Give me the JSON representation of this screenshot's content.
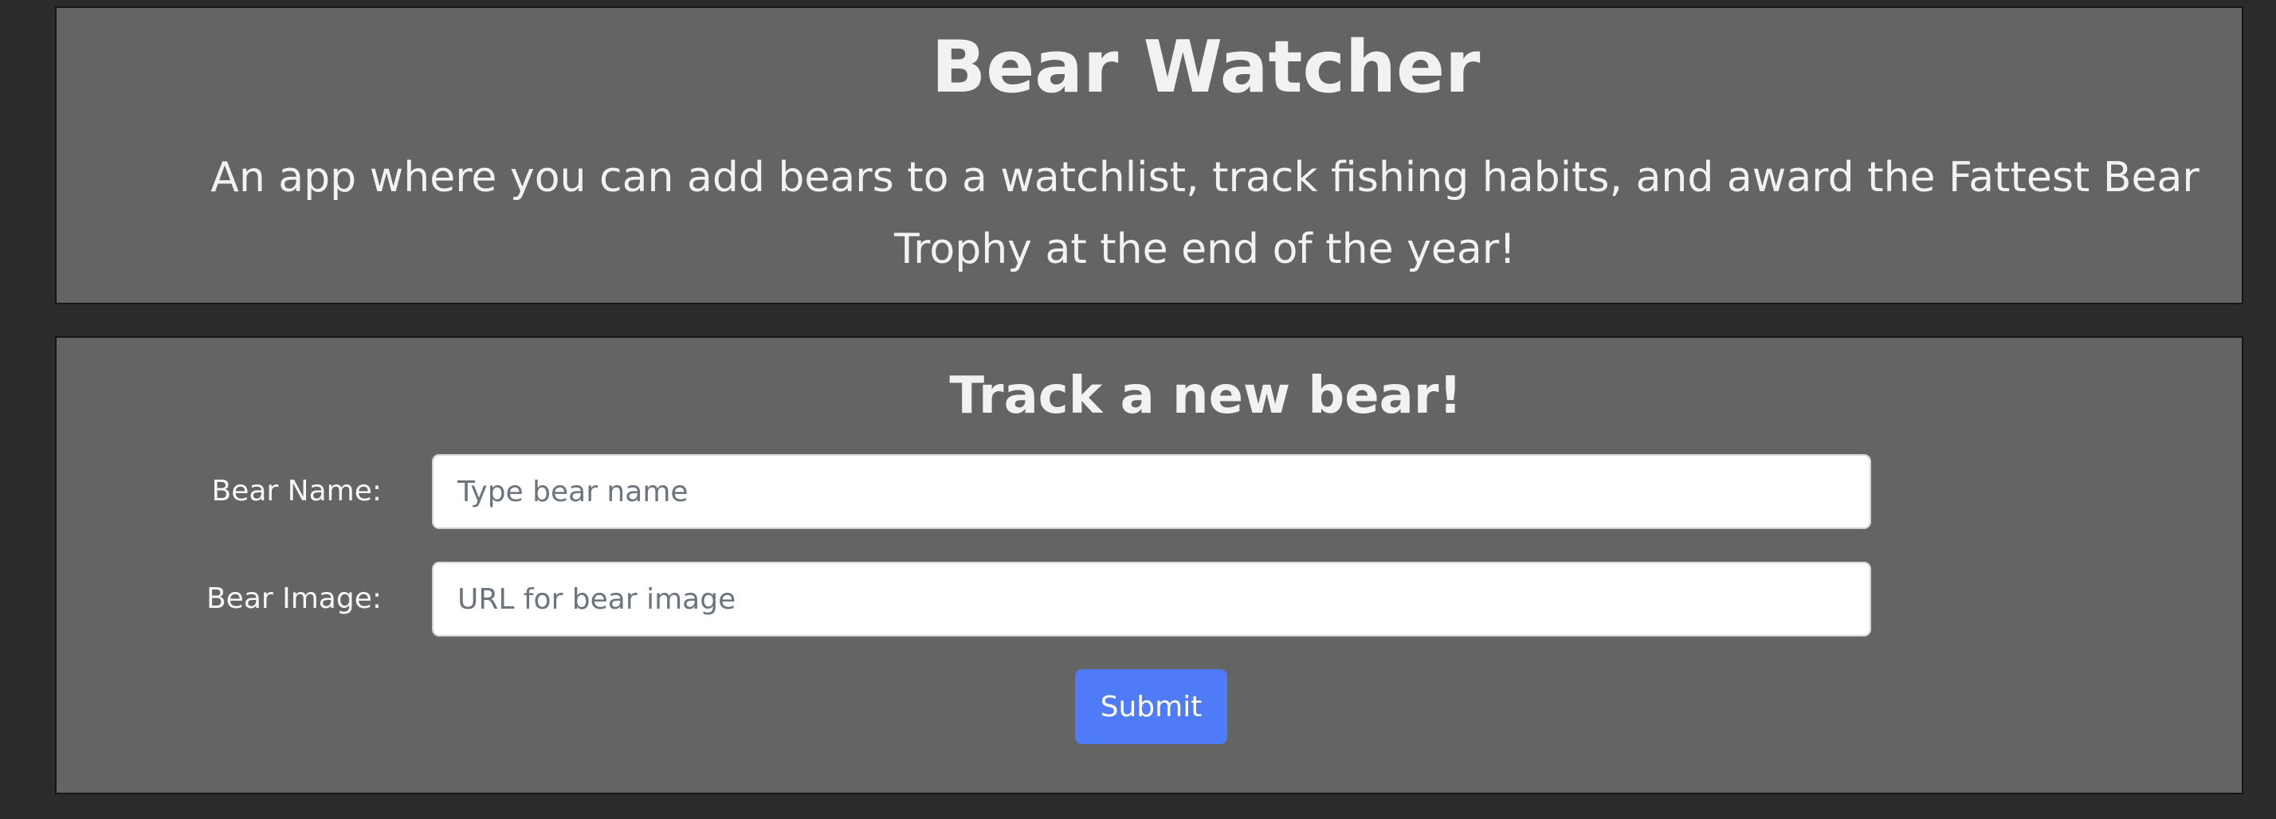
{
  "header": {
    "title": "Bear Watcher",
    "subtitle": "An app where you can add bears to a watchlist, track fishing habits, and award the Fattest Bear Trophy at the end of the year!"
  },
  "form": {
    "title": "Track a new bear!",
    "name_label": "Bear Name:",
    "name_placeholder": "Type bear name",
    "name_value": "",
    "image_label": "Bear Image:",
    "image_placeholder": "URL for bear image",
    "image_value": "",
    "submit_label": "Submit"
  },
  "colors": {
    "page_background": "#2b2b2b",
    "panel_background": "#646464",
    "panel_border": "#161616",
    "submit_button": "#4f7cf6",
    "text": "#f2f2f2"
  }
}
